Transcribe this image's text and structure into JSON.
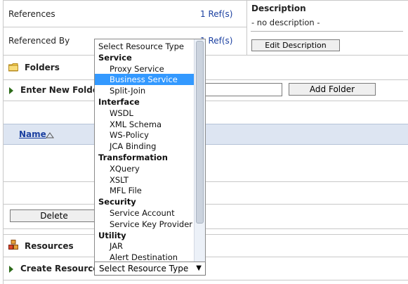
{
  "summary": {
    "references_label": "References",
    "references_value": "1 Ref(s)",
    "referenced_by_label": "Referenced By",
    "referenced_by_value": "1 Ref(s)",
    "description_title": "Description",
    "description_value": "- no description -",
    "edit_description_button": "Edit Description"
  },
  "folders": {
    "title": "Folders",
    "enter_new_folder_label": "Enter New Folder",
    "add_folder_button": "Add Folder",
    "name_column": "Name",
    "delete_button": "Delete"
  },
  "resources": {
    "title": "Resources",
    "create_resource_label": "Create Resource:",
    "select_value": "Select Resource Type"
  },
  "dropdown": {
    "options": [
      {
        "label": "Select Resource Type",
        "kind": "plain"
      },
      {
        "label": "Service",
        "kind": "group"
      },
      {
        "label": "Proxy Service",
        "kind": "item"
      },
      {
        "label": "Business Service",
        "kind": "item",
        "selected": true
      },
      {
        "label": "Split-Join",
        "kind": "item"
      },
      {
        "label": "Interface",
        "kind": "group"
      },
      {
        "label": "WSDL",
        "kind": "item"
      },
      {
        "label": "XML Schema",
        "kind": "item"
      },
      {
        "label": "WS-Policy",
        "kind": "item"
      },
      {
        "label": "JCA Binding",
        "kind": "item"
      },
      {
        "label": "Transformation",
        "kind": "group"
      },
      {
        "label": "XQuery",
        "kind": "item"
      },
      {
        "label": "XSLT",
        "kind": "item"
      },
      {
        "label": "MFL File",
        "kind": "item"
      },
      {
        "label": "Security",
        "kind": "group"
      },
      {
        "label": "Service Account",
        "kind": "item"
      },
      {
        "label": "Service Key Provider",
        "kind": "item"
      },
      {
        "label": "Utility",
        "kind": "group"
      },
      {
        "label": "JAR",
        "kind": "item"
      },
      {
        "label": "Alert Destination",
        "kind": "item"
      }
    ]
  },
  "colors": {
    "link": "#1a3fa0",
    "selection": "#3399ff",
    "table_header_bg": "#dde5f2"
  },
  "icons": {
    "folder": "folder-icon",
    "resources": "resources-icon",
    "sort": "sort-ascending-icon",
    "expand": "expand-arrow-icon"
  }
}
